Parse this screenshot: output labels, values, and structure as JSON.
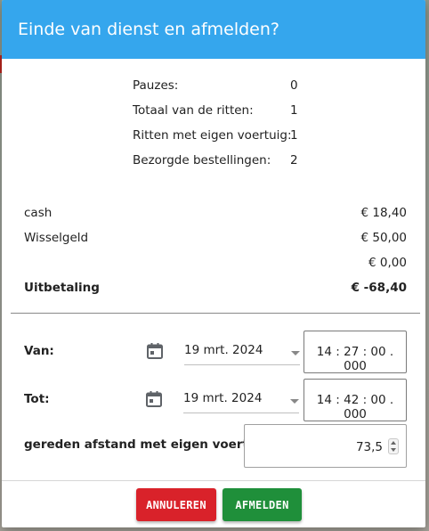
{
  "dialog": {
    "title": "Einde van dienst en afmelden?"
  },
  "stats": [
    {
      "label": "Pauzes:",
      "value": "0"
    },
    {
      "label": "Totaal van de ritten:",
      "value": "1"
    },
    {
      "label": "Ritten met eigen voertuig:",
      "value": "1"
    },
    {
      "label": "Bezorgde bestellingen:",
      "value": "2"
    }
  ],
  "money": [
    {
      "label": "cash",
      "value": "€ 18,40"
    },
    {
      "label": "Wisselgeld",
      "value": "€ 50,00"
    },
    {
      "label": "",
      "value": "€ 0,00"
    },
    {
      "label": "Uitbetaling",
      "value": "€ -68,40"
    }
  ],
  "from": {
    "label": "Van:",
    "date": "19 mrt. 2024",
    "time": "14 : 27 : 00 . 000"
  },
  "to": {
    "label": "Tot:",
    "date": "19 mrt. 2024",
    "time": "14 : 42 : 00 . 000"
  },
  "distance": {
    "label": "gereden afstand met eigen voertuig:",
    "value": "73,5"
  },
  "buttons": {
    "cancel": "ANNULEREN",
    "logoff": "AFMELDEN"
  },
  "colors": {
    "header": "#35a6ed",
    "cancel": "#d9222a",
    "logoff": "#1f8f3a"
  },
  "icons": {
    "calendar": "calendar-icon",
    "spinner": "number-spinner-icon",
    "dropdown": "dropdown-arrow-icon"
  }
}
